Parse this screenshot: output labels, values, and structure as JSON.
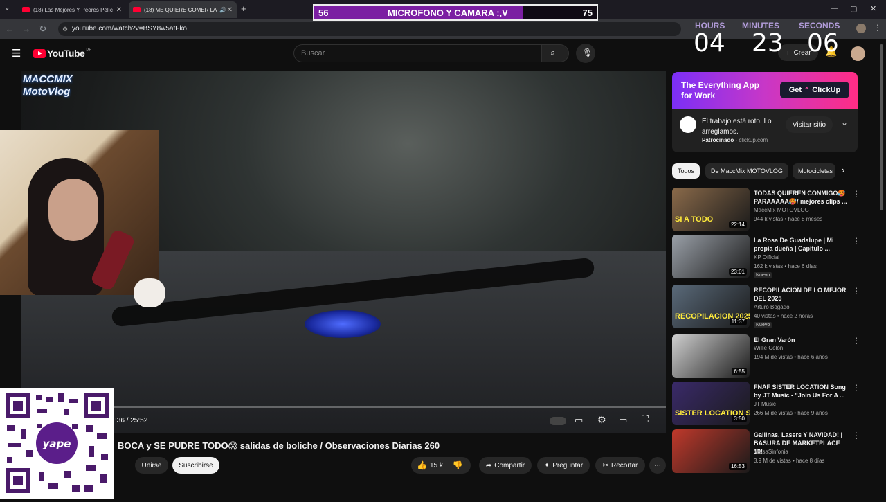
{
  "browser": {
    "tabs": [
      {
        "title": "(18) Las Mejores Y Peores Pelíc"
      },
      {
        "title": "(18) ME QUIERE COMER LA"
      }
    ],
    "url": "youtube.com/watch?v=BSY8w5atFko"
  },
  "overlay": {
    "mic_left": "56",
    "mic_text": "MICROFONO Y CAMARA :,V",
    "mic_right": "75",
    "timer": {
      "hours_label": "HOURS",
      "minutes_label": "MINUTES",
      "seconds_label": "SECONDS",
      "hours": "04",
      "minutes": "23",
      "seconds": "06"
    },
    "player_time": ":36 / 25:52"
  },
  "youtube": {
    "logo": "YouTube",
    "region": "PE",
    "search_placeholder": "Buscar",
    "create_label": "Crear",
    "video_title": "BOCA y SE PUDRE TODO😱 salidas de boliche / Observaciones Diarias 260",
    "watermark": "MACCMIX MotoVlog",
    "join_label": "Unirse",
    "subscribe_label": "Suscribirse",
    "likes": "15 k",
    "share_label": "Compartir",
    "ask_label": "Preguntar",
    "clip_label": "Recortar"
  },
  "ad": {
    "banner_text": "The Everything App for Work",
    "banner_cta": "Get",
    "brand": "ClickUp",
    "body": "El trabajo está roto. Lo arreglamos.",
    "sponsored": "Patrocinado",
    "domain": "clickup.com",
    "visit_label": "Visitar sitio"
  },
  "chips": [
    "Todos",
    "De MaccMix MOTOVLOG",
    "Motocicletas"
  ],
  "recommendations": [
    {
      "title": "TODAS QUIEREN CONMIGO🥵 PARAAAAA🥵/ mejores clips ...",
      "channel": "MaccMix MOTOVLOG",
      "meta": "944 k vistas • hace 8 meses",
      "duration": "22:14",
      "badge": "",
      "thumb_text": "SI A TODO",
      "color": "#8a6a4a"
    },
    {
      "title": "La Rosa De Guadalupe | Mi propia dueña | Capítulo ...",
      "channel": "KP Official",
      "meta": "162 k vistas • hace 6 días",
      "duration": "23:01",
      "badge": "Nuevo",
      "thumb_text": "",
      "color": "#9aa0a8"
    },
    {
      "title": "RECOPILACIÓN DE LO MEJOR DEL 2025",
      "channel": "Arturo Bogado",
      "meta": "40 vistas • hace 2 horas",
      "duration": "11:37",
      "badge": "Nuevo",
      "thumb_text": "RECOPILACION 2025",
      "color": "#5a6a7a"
    },
    {
      "title": "El Gran Varón",
      "channel": "Willie Colón",
      "meta": "194 M de vistas • hace 6 años",
      "duration": "6:55",
      "badge": "",
      "thumb_text": "",
      "color": "#cfcfcf"
    },
    {
      "title": "FNAF SISTER LOCATION Song by JT Music - \"Join Us For A ...",
      "channel": "JT Music",
      "meta": "266 M de vistas • hace 9 años",
      "duration": "3:50",
      "badge": "",
      "thumb_text": "SISTER LOCATION SONG",
      "color": "#3a2a6a"
    },
    {
      "title": "Gallinas, Lasers Y NAVIDAD! | BASURA DE MARKETPLACE 10!",
      "channel": "MissaSinfonia",
      "meta": "3.9 M de vistas • hace 8 días",
      "duration": "16:53",
      "badge": "",
      "thumb_text": "",
      "color": "#c0392b"
    }
  ]
}
